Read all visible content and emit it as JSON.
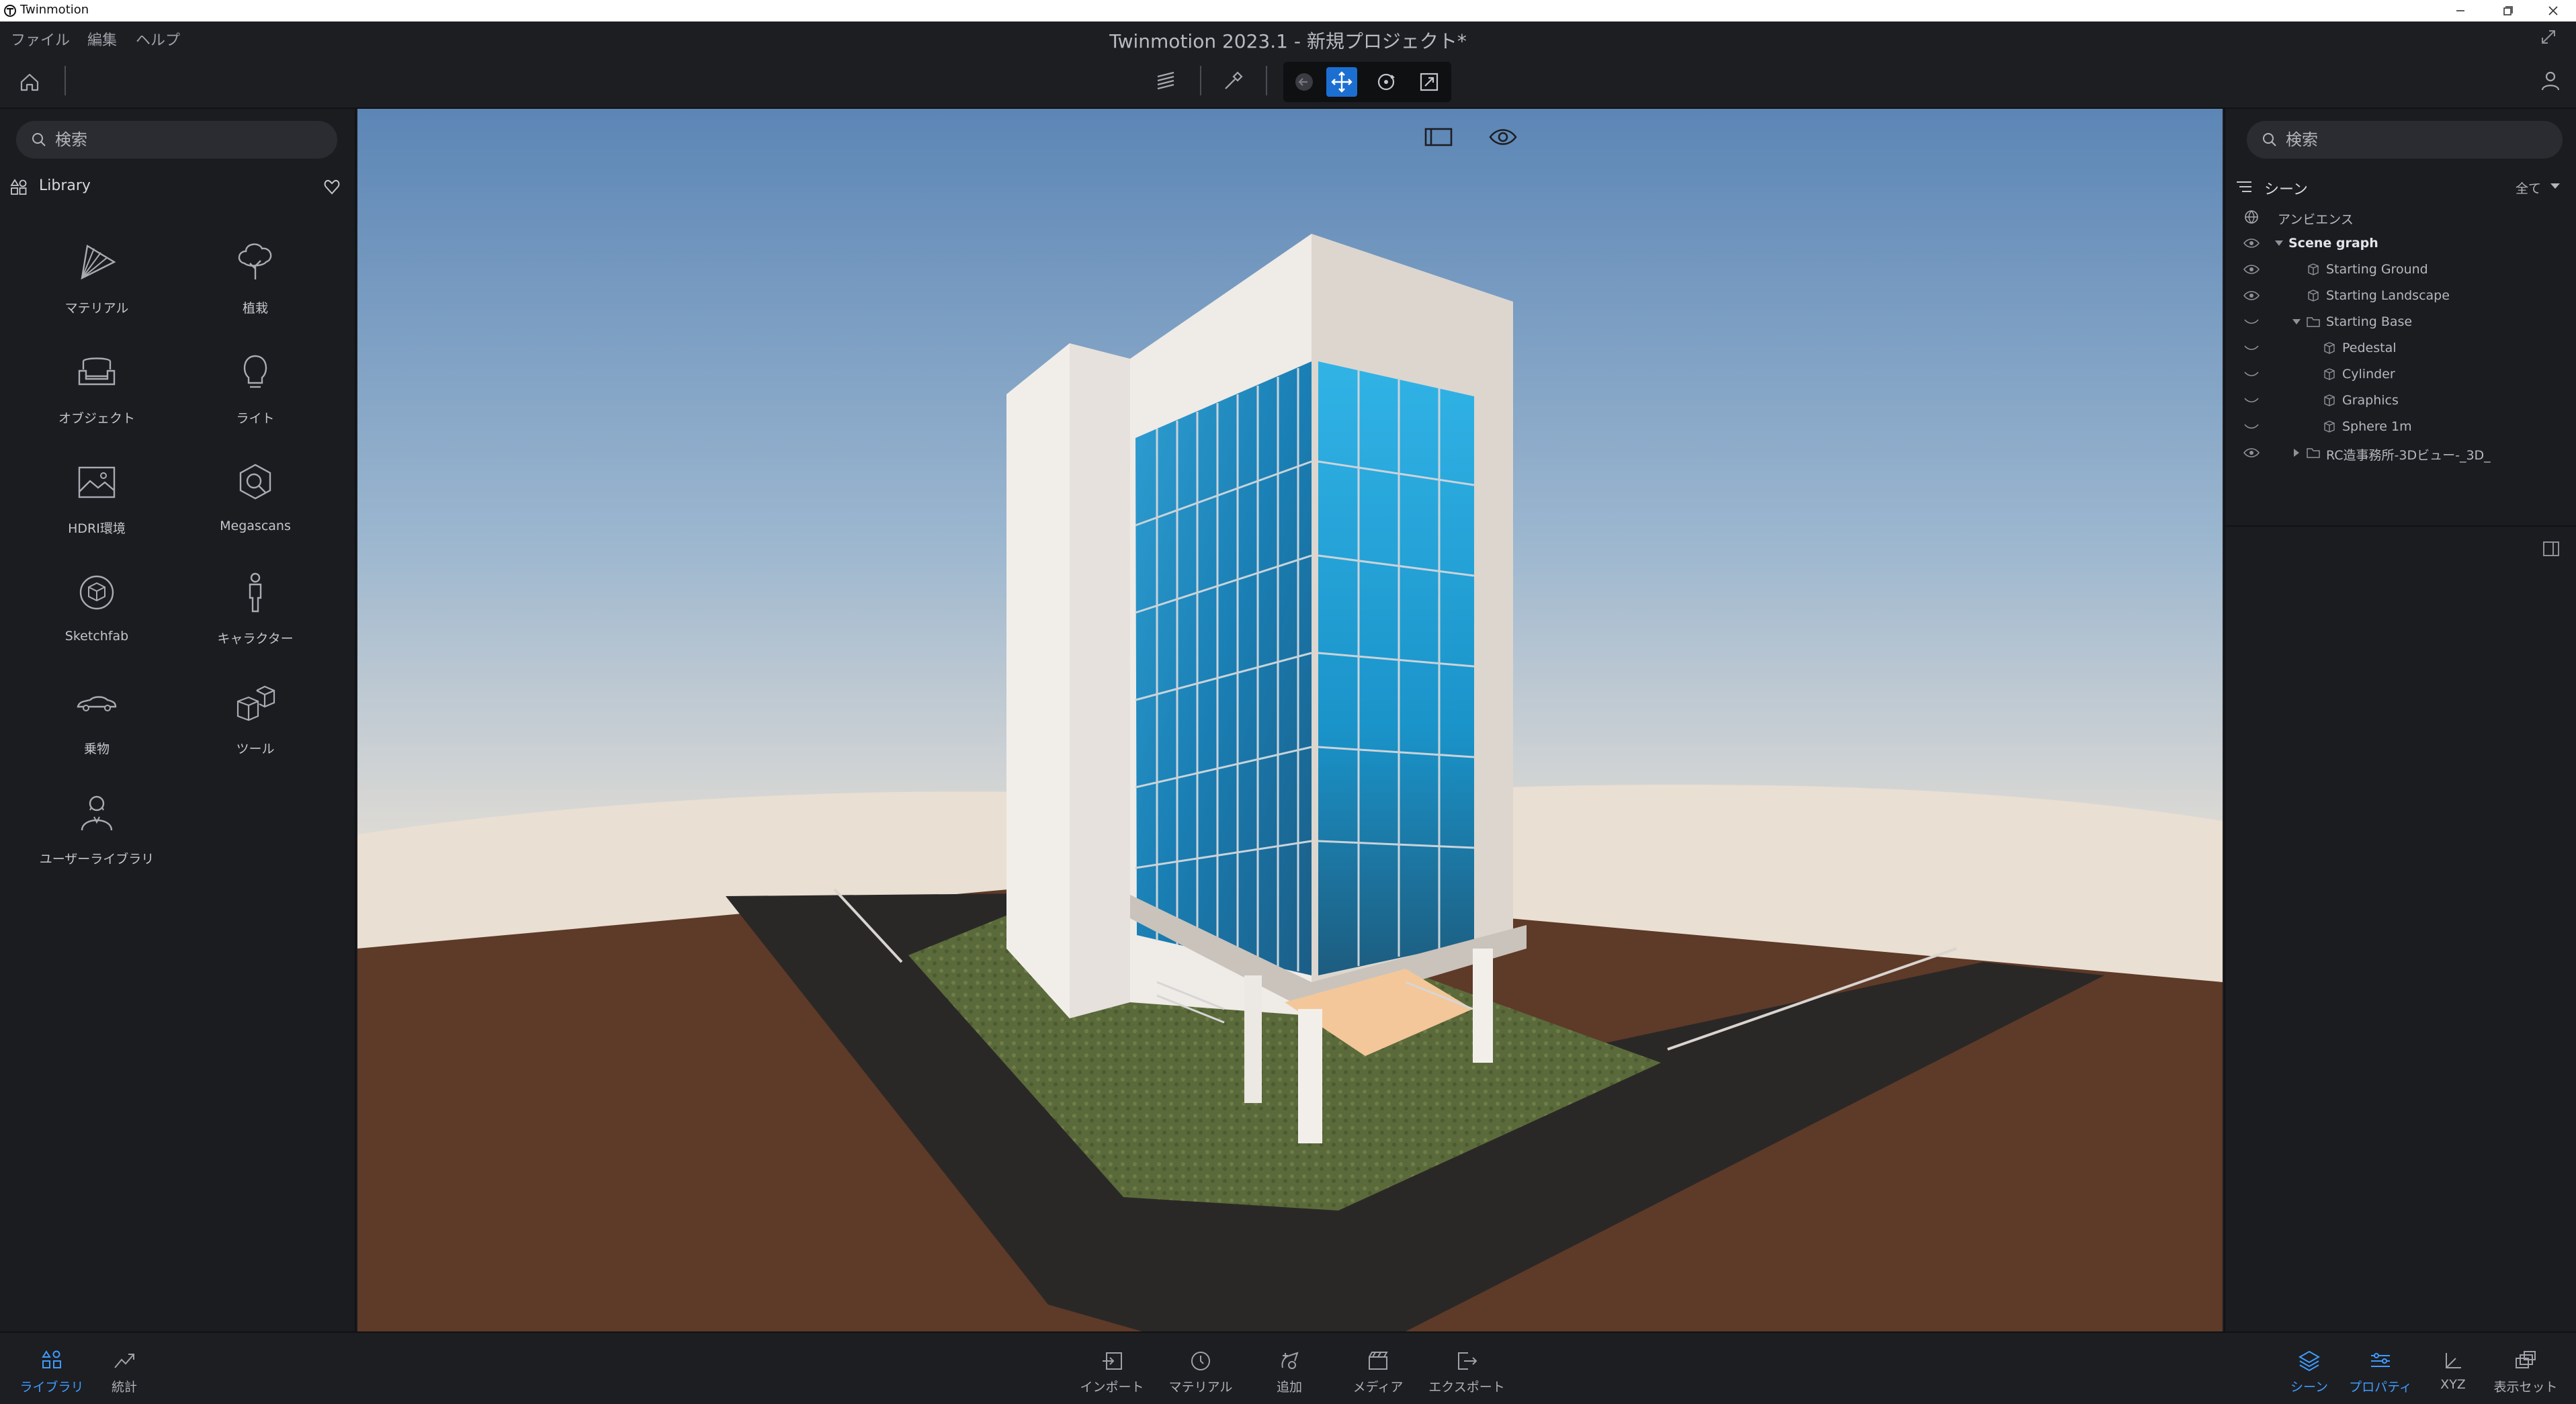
{
  "window": {
    "app_name": "Twinmotion"
  },
  "menu": {
    "items": [
      "ファイル",
      "編集",
      "ヘルプ"
    ],
    "project_title": "Twinmotion 2023.1 - 新規プロジェクト*"
  },
  "left_panel": {
    "search_placeholder": "検索",
    "library_label": "Library",
    "tiles": [
      {
        "label": "マテリアル",
        "icon": "material-fan-icon"
      },
      {
        "label": "植栽",
        "icon": "tree-icon"
      },
      {
        "label": "オブジェクト",
        "icon": "sofa-icon"
      },
      {
        "label": "ライト",
        "icon": "lightbulb-icon"
      },
      {
        "label": "HDRI環境",
        "icon": "hdri-image-icon"
      },
      {
        "label": "Megascans",
        "icon": "megascans-icon"
      },
      {
        "label": "Sketchfab",
        "icon": "sketchfab-icon"
      },
      {
        "label": "キャラクター",
        "icon": "character-icon"
      },
      {
        "label": "乗物",
        "icon": "car-icon"
      },
      {
        "label": "ツール",
        "icon": "cubes-icon"
      },
      {
        "label": "ユーザーライブラリ",
        "icon": "user-library-icon"
      }
    ]
  },
  "right_panel": {
    "search_placeholder": "検索",
    "scene_label": "シーン",
    "filter_value": "全て",
    "tree": [
      {
        "label": "アンビエンス",
        "indent": 0,
        "type": "ambience",
        "eye": "none",
        "arrow": "none",
        "bold": false
      },
      {
        "label": "Scene graph",
        "indent": 1,
        "type": "none",
        "eye": "open",
        "arrow": "down",
        "bold": true
      },
      {
        "label": "Starting Ground",
        "indent": 2,
        "type": "object",
        "eye": "open",
        "arrow": "none",
        "bold": false
      },
      {
        "label": "Starting Landscape",
        "indent": 2,
        "type": "object",
        "eye": "open",
        "arrow": "none",
        "bold": false
      },
      {
        "label": "Starting Base",
        "indent": 2,
        "type": "folder",
        "eye": "closed",
        "arrow": "down",
        "bold": false
      },
      {
        "label": "Pedestal",
        "indent": 3,
        "type": "object",
        "eye": "closed",
        "arrow": "none",
        "bold": false
      },
      {
        "label": "Cylinder",
        "indent": 3,
        "type": "object",
        "eye": "closed",
        "arrow": "none",
        "bold": false
      },
      {
        "label": "Graphics",
        "indent": 3,
        "type": "object",
        "eye": "closed",
        "arrow": "none",
        "bold": false
      },
      {
        "label": "Sphere 1m",
        "indent": 3,
        "type": "object",
        "eye": "closed",
        "arrow": "none",
        "bold": false
      },
      {
        "label": "RC造事務所-3Dビュー-_3D_",
        "indent": 2,
        "type": "folder",
        "eye": "open",
        "arrow": "right",
        "bold": false
      }
    ]
  },
  "bottom": {
    "left": [
      {
        "label": "ライブラリ",
        "icon": "library-icon",
        "active": true
      },
      {
        "label": "統計",
        "icon": "stats-icon",
        "active": false
      }
    ],
    "center": [
      {
        "label": "インポート",
        "icon": "import-icon"
      },
      {
        "label": "マテリアル",
        "icon": "material-picker-icon"
      },
      {
        "label": "追加",
        "icon": "add-icon"
      },
      {
        "label": "メディア",
        "icon": "media-icon"
      },
      {
        "label": "エクスポート",
        "icon": "export-icon"
      }
    ],
    "right": [
      {
        "label": "シーン",
        "icon": "scene-layers-icon",
        "active": true
      },
      {
        "label": "プロパティ",
        "icon": "properties-icon",
        "active": true
      },
      {
        "label": "XYZ",
        "icon": "xyz-icon",
        "active": false
      },
      {
        "label": "表示セット",
        "icon": "display-set-icon",
        "active": false
      }
    ]
  },
  "colors": {
    "accent": "#1c6fd1",
    "active_text": "#3f9cff",
    "panel_bg": "#1b1c20"
  }
}
